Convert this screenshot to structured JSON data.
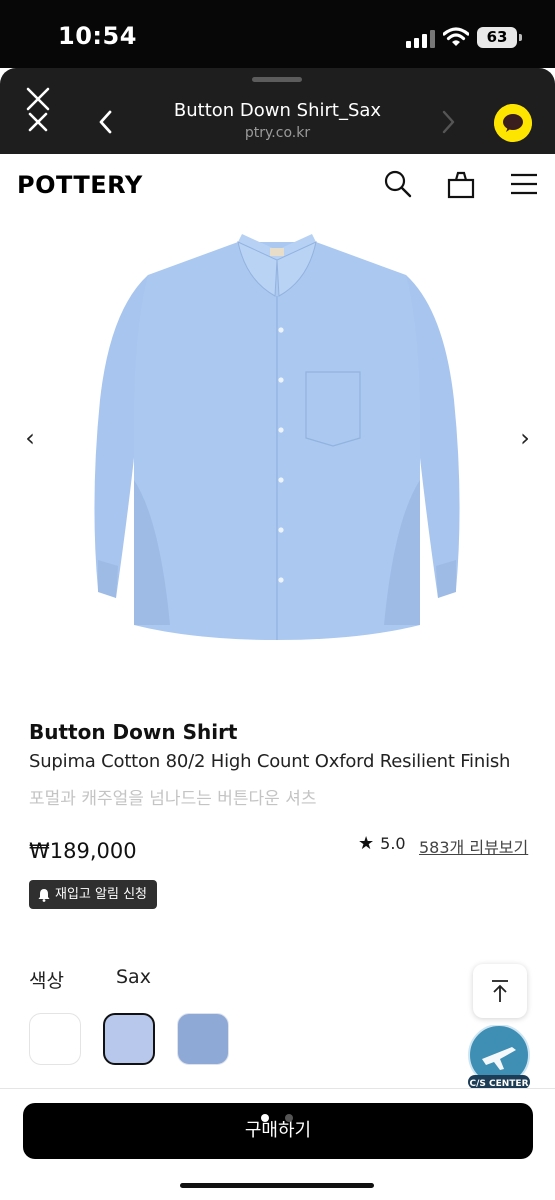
{
  "status_bar": {
    "time": "10:54",
    "battery": "63"
  },
  "browser": {
    "title": "Button Down Shirt_Sax",
    "url": "ptry.co.kr",
    "icons": [
      "close-icon",
      "back-icon",
      "forward-icon",
      "kakaotalk-icon"
    ]
  },
  "site": {
    "logo": "POTTERY",
    "icons": [
      "search-icon",
      "bag-icon",
      "menu-icon"
    ]
  },
  "gallery": {
    "prev": "‹",
    "next": "›",
    "shirt_color": "#a9c8ef"
  },
  "product": {
    "name": "Button Down Shirt",
    "description": "Supima Cotton 80/2 High Count Oxford Resilient Finish",
    "subtitle": "포멀과 캐주얼을 넘나드는 버튼다운 셔츠",
    "price": "₩189,000",
    "rating": "5.0",
    "reviews_link": "583개 리뷰보기",
    "restock_label": "재입고 알림 신청"
  },
  "options": {
    "color_label": "색상",
    "color_value": "Sax",
    "swatches": [
      {
        "name": "white",
        "color": "#ffffff"
      },
      {
        "name": "sax",
        "color": "#b8c8ec",
        "selected": true
      },
      {
        "name": "blue",
        "color": "#8fa9d6"
      }
    ]
  },
  "floating": {
    "cs_center_label": "C/S CENTER"
  },
  "cta": {
    "buy_label": "구매하기"
  }
}
